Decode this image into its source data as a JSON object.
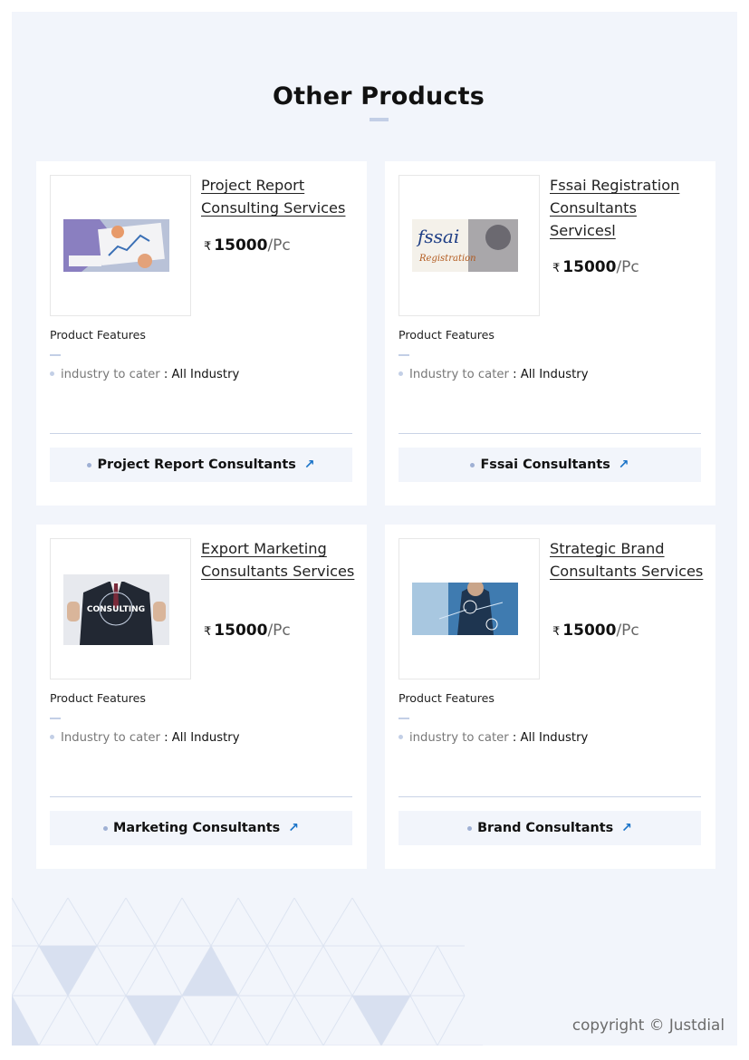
{
  "section": {
    "title": "Other Products"
  },
  "products": [
    {
      "name": "Project Report Consulting Services",
      "image_icon": "project-report-photo",
      "currency": "₹",
      "price": "15000",
      "unit": "/Pc",
      "features_title": "Product Features",
      "feature_label": "industry to cater",
      "feature_sep": " : ",
      "feature_value": "All Industry",
      "category": "Project Report Consultants",
      "arrow": "↗"
    },
    {
      "name": "Fssai Registration Consultants Servicesl",
      "image_icon": "fssai-registration-photo",
      "image_text": "fssai",
      "image_subtext": "Registration",
      "currency": "₹",
      "price": "15000",
      "unit": "/Pc",
      "features_title": "Product Features",
      "feature_label": "Industry to cater",
      "feature_sep": " : ",
      "feature_value": "All Industry",
      "category": "Fssai Consultants",
      "arrow": "↗"
    },
    {
      "name": "Export Marketing Consultants Services",
      "image_icon": "consulting-businessman-photo",
      "image_text": "CONSULTING",
      "currency": "₹",
      "price": "15000",
      "unit": "/Pc",
      "features_title": "Product Features",
      "feature_label": "Industry to cater",
      "feature_sep": " : ",
      "feature_value": "All Industry",
      "category": "Marketing Consultants",
      "arrow": "↗"
    },
    {
      "name": "Strategic Brand Consultants Services",
      "image_icon": "brand-consulting-photo",
      "currency": "₹",
      "price": "15000",
      "unit": "/Pc",
      "features_title": "Product Features",
      "feature_label": "industry to cater",
      "feature_sep": " : ",
      "feature_value": "All Industry",
      "category": "Brand Consultants",
      "arrow": "↗"
    }
  ],
  "footer": {
    "copyright": "copyright © Justdial"
  },
  "colors": {
    "page_bg": "#f2f5fb",
    "accent": "#c3cfe6",
    "link_arrow": "#1a73c8"
  }
}
